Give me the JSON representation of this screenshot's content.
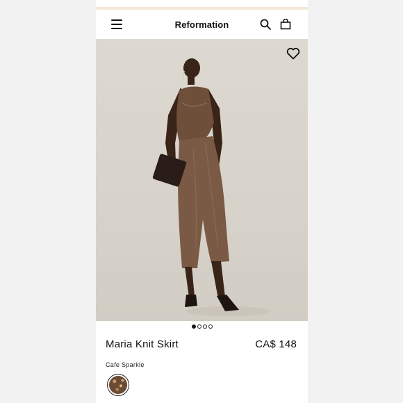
{
  "header": {
    "brand": "Reformation",
    "menu_icon": "hamburger-menu-icon",
    "search_icon": "search-icon",
    "bag_icon": "shopping-bag-icon"
  },
  "product": {
    "wishlist_icon": "heart-icon",
    "image_count": 4,
    "active_image_index": 0,
    "name": "Maria Knit Skirt",
    "price": "CA$ 148",
    "color_name": "Cafe Sparkle",
    "swatch_colors": [
      "#6a4a32",
      "#c79a6c"
    ]
  }
}
